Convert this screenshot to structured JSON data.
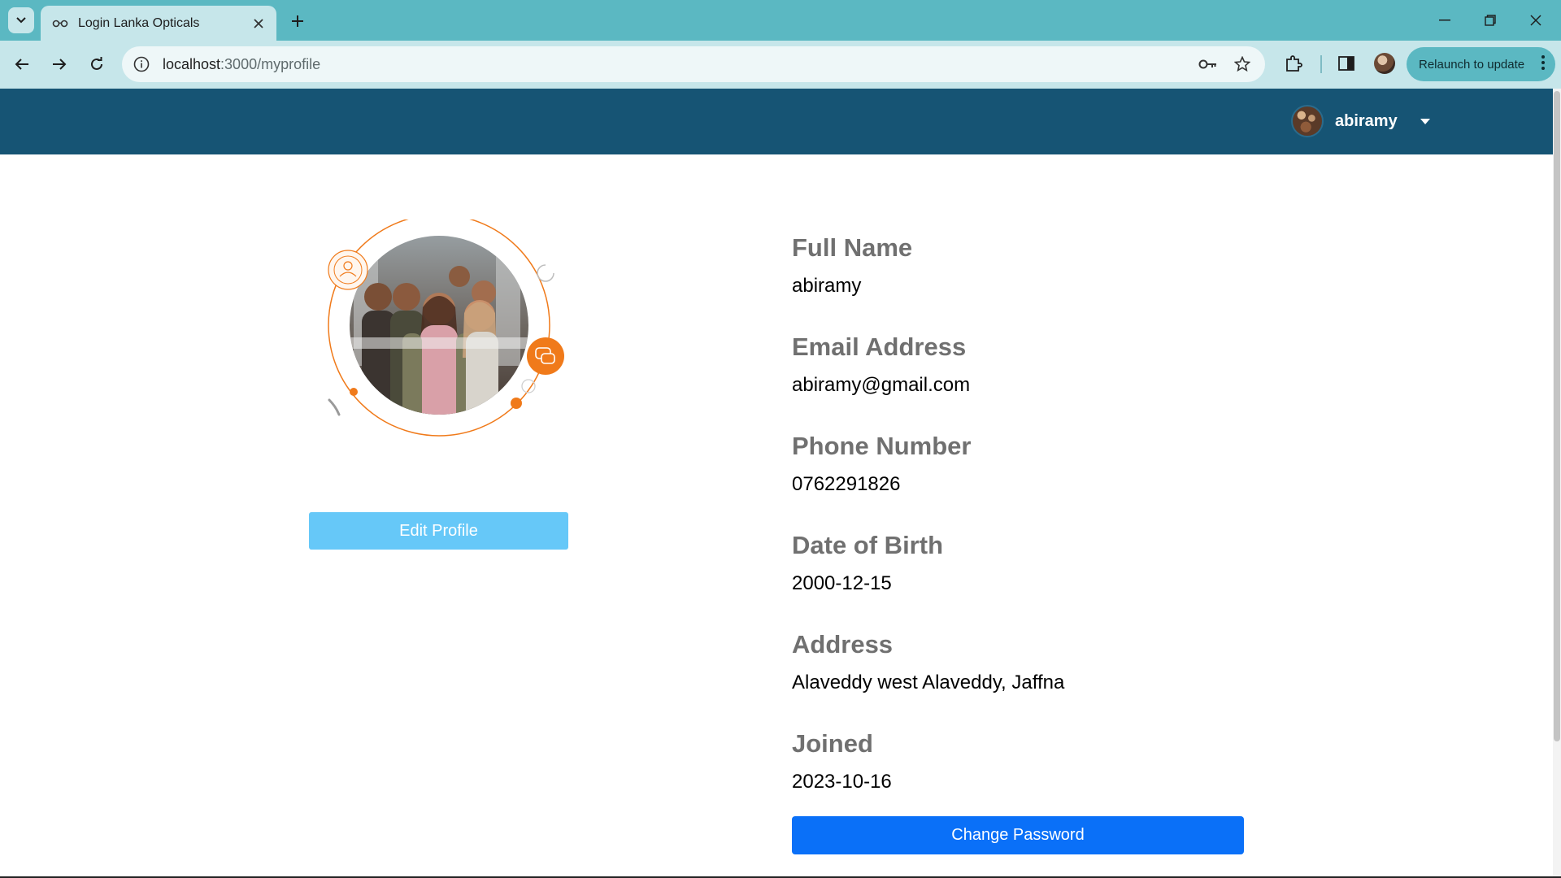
{
  "browser": {
    "tab_title": "Login Lanka Opticals",
    "url_host": "localhost",
    "url_path": ":3000/myprofile",
    "relaunch_label": "Relaunch to update"
  },
  "header": {
    "username": "abiramy",
    "bg_color": "#165474"
  },
  "profile": {
    "edit_label": "Edit Profile",
    "change_password_label": "Change Password",
    "fields": [
      {
        "label": "Full Name",
        "value": "abiramy"
      },
      {
        "label": "Email Address",
        "value": "abiramy@gmail.com"
      },
      {
        "label": "Phone Number",
        "value": "0762291826"
      },
      {
        "label": "Date of Birth",
        "value": "2000-12-15"
      },
      {
        "label": "Address",
        "value": "Alaveddy west Alaveddy, Jaffna"
      },
      {
        "label": "Joined",
        "value": "2023-10-16"
      }
    ]
  },
  "colors": {
    "accent_orange": "#f07a1a",
    "edit_button": "#66c8f8",
    "password_button": "#0a70f8"
  }
}
